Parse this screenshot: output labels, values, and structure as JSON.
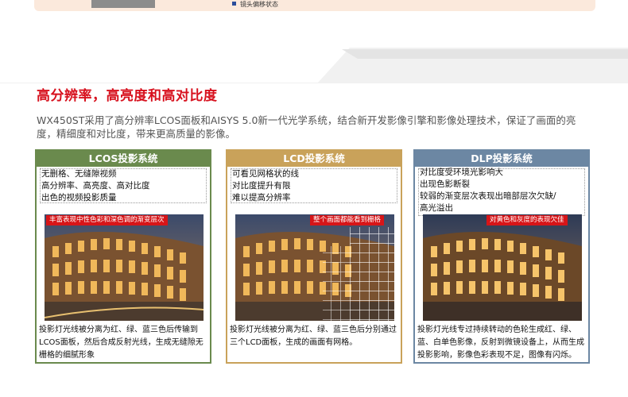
{
  "top": {
    "caption": "镜头偏移状态"
  },
  "heading": "高分辨率，高亮度和高对比度",
  "intro": "WX450ST采用了高分辨率LCOS面板和AISYS 5.0新一代光学系统，结合新开发影像引擎和影像处理技术，保证了画面的亮度，精细度和对比度，带来更高质量的影像。",
  "panels": [
    {
      "title": "LCOS投影系统",
      "color": "#6a8a4d",
      "features": [
        "无删格、无缝隙视频",
        "高分辨率、高亮度、高对比度",
        "出色的视频投影质量"
      ],
      "photo_caption": "丰富表现中性色彩和深色调的渐变层次",
      "description": "投影灯光线被分离为红、绿、蓝三色后传输到LCOS面板，然后合成反射光线，生成无缝隙无栅格的细腻形象"
    },
    {
      "title": "LCD投影系统",
      "color": "#c9a25a",
      "features": [
        "可看见网格状的线",
        "对比度提升有限",
        "难以提高分辨率"
      ],
      "photo_caption": "整个画面都能看到栅格",
      "description": "投影灯光线被分离为红、绿、蓝三色后分别通过三个LCD面板，生成的画面有网格。"
    },
    {
      "title": "DLP投影系统",
      "color": "#6c87a3",
      "features": [
        "对比度受环境光影响大",
        "出现色影断裂",
        "较弱的渐变层次表现出暗部层次欠缺/",
        "高光溢出"
      ],
      "photo_caption": "对黄色和灰度的表现欠佳",
      "description": "投影灯光线专过持续转动的色轮生成红、绿、蓝、白单色影像，反射到微镜设备上，从而生成投影影响，影像色彩表现不足，图像有闪烁。"
    }
  ]
}
